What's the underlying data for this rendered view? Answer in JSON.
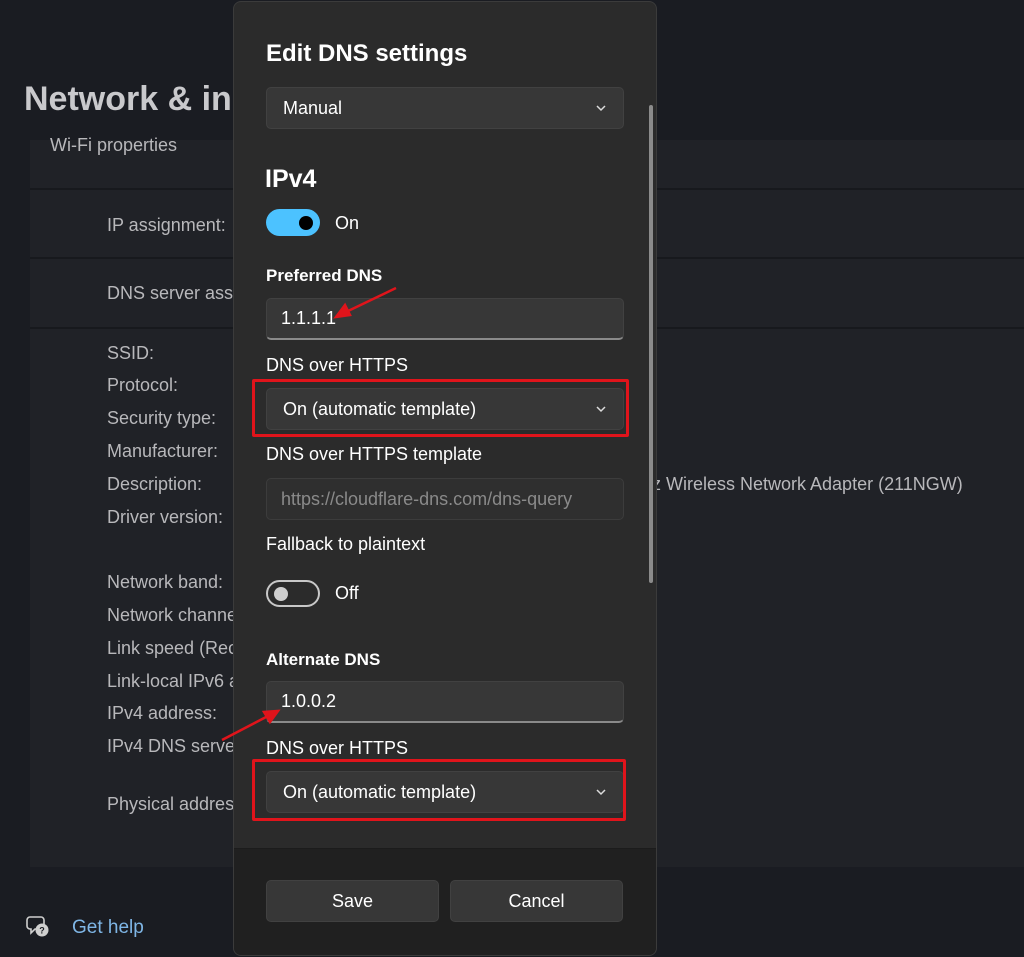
{
  "background": {
    "page_title": "Network & in",
    "card_header": "Wi-Fi properties",
    "rows": [
      {
        "label": "IP assignment:"
      },
      {
        "label": "DNS server assi"
      }
    ],
    "props": [
      "SSID:",
      "Protocol:",
      "Security type:",
      "Manufacturer:",
      "Description:",
      "Driver version:",
      "Network band:",
      "Network channe",
      "Link speed (Rec",
      "Link-local IPv6 a",
      "IPv4 address:",
      "IPv4 DNS server",
      "Physical address"
    ],
    "description_value": "z Wireless Network Adapter (211NGW)",
    "get_help": "Get help"
  },
  "dialog": {
    "title": "Edit DNS settings",
    "mode_select": "Manual",
    "ipv4_heading": "IPv4",
    "ipv4_toggle": {
      "state": "on",
      "label": "On"
    },
    "preferred_dns_label": "Preferred DNS",
    "preferred_dns_value": "1.1.1.1",
    "doh_label_1": "DNS over HTTPS",
    "doh_select_1": "On (automatic template)",
    "doh_template_label": "DNS over HTTPS template",
    "doh_template_value": "https://cloudflare-dns.com/dns-query",
    "fallback_label": "Fallback to plaintext",
    "fallback_toggle": {
      "state": "off",
      "label": "Off"
    },
    "alternate_dns_label": "Alternate DNS",
    "alternate_dns_value": "1.0.0.2",
    "doh_label_2": "DNS over HTTPS",
    "doh_select_2": "On (automatic template)",
    "save_label": "Save",
    "cancel_label": "Cancel"
  },
  "colors": {
    "accent": "#4cc2ff",
    "annotation_red": "#e0141b",
    "link": "#7fb6e6"
  }
}
